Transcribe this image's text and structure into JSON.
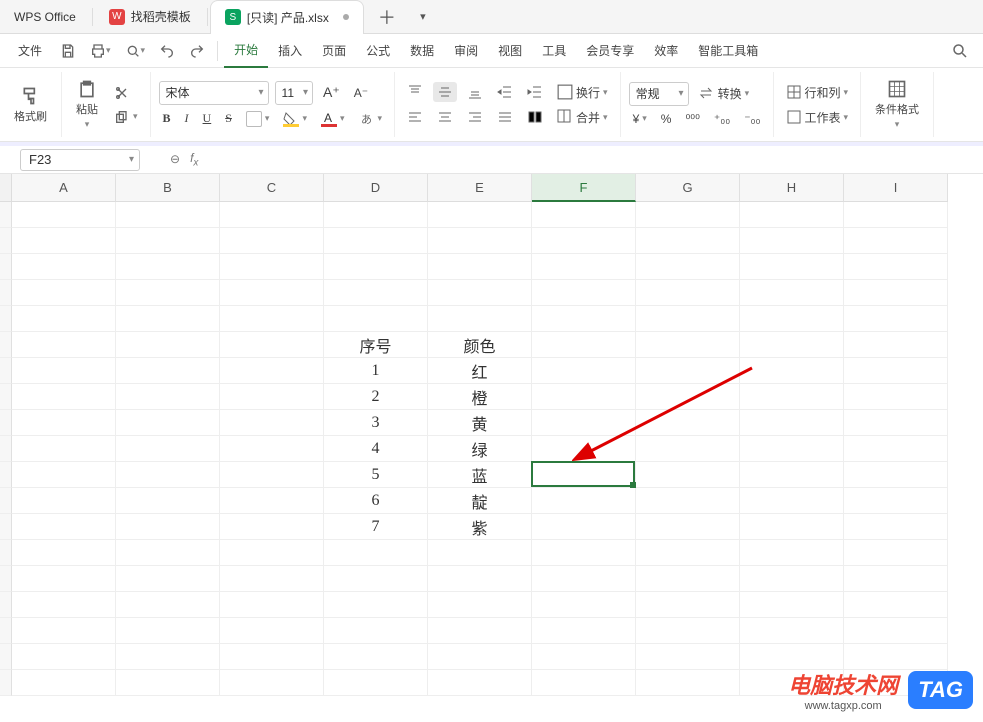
{
  "app_name": "WPS Office",
  "tabs": [
    {
      "icon_color": "red",
      "icon_letter": "W",
      "label": "找稻壳模板"
    },
    {
      "icon_color": "green",
      "icon_letter": "S",
      "label": "[只读] 产品.xlsx",
      "active": true,
      "dirty": true
    }
  ],
  "menus": {
    "file": "文件",
    "items": [
      "开始",
      "插入",
      "页面",
      "公式",
      "数据",
      "审阅",
      "视图",
      "工具",
      "会员专享",
      "效率",
      "智能工具箱"
    ],
    "active_index": 0
  },
  "ribbon": {
    "format_brush": "格式刷",
    "paste": "粘贴",
    "font_name": "宋体",
    "font_size": "11",
    "bold": "B",
    "italic": "I",
    "underline": "U",
    "strike": "S",
    "wrap": "换行",
    "merge": "合并",
    "number_format": "常规",
    "convert": "转换",
    "currency": "¥",
    "percent": "%",
    "row_col": "行和列",
    "worksheet": "工作表",
    "cond_format": "条件格式"
  },
  "namebox": "F23",
  "formula": "",
  "columns": [
    "A",
    "B",
    "C",
    "D",
    "E",
    "F",
    "G",
    "H",
    "I"
  ],
  "selected_col_index": 5,
  "sheet_data": {
    "D": {
      "header": "序号",
      "values": [
        "1",
        "2",
        "3",
        "4",
        "5",
        "6",
        "7"
      ]
    },
    "E": {
      "header": "颜色",
      "values": [
        "红",
        "橙",
        "黄",
        "绿",
        "蓝",
        "靛",
        "紫"
      ]
    }
  },
  "data_start_row_index": 5,
  "selected_cell": {
    "col_index": 5,
    "row_index": 10
  },
  "watermark": {
    "title": "电脑技术网",
    "url": "www.tagxp.com",
    "tag": "TAG"
  }
}
